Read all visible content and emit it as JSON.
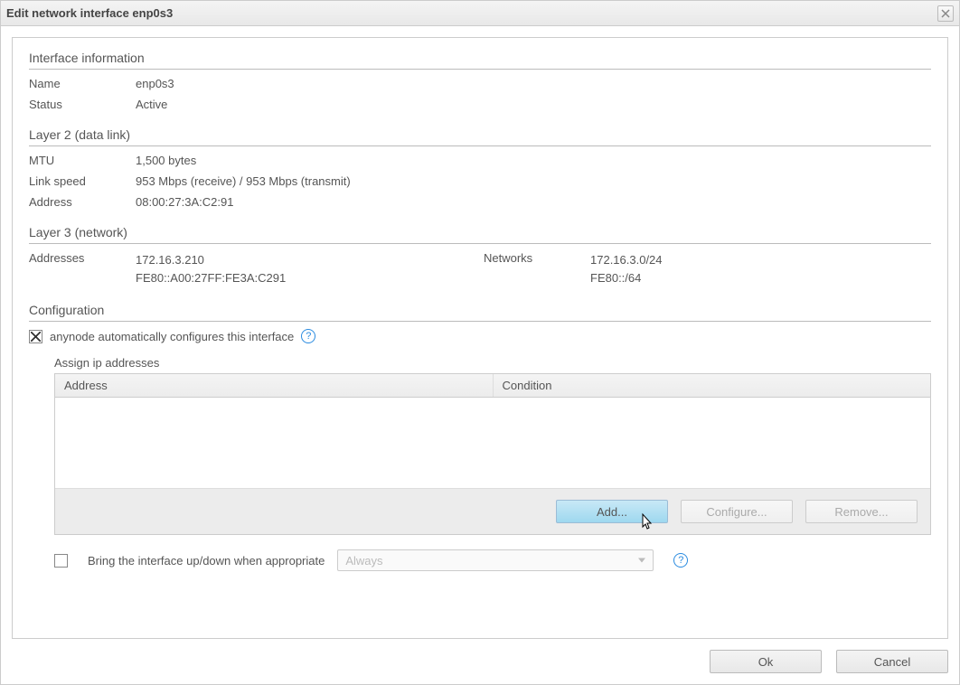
{
  "window": {
    "title": "Edit network interface enp0s3"
  },
  "sections": {
    "interface_info": {
      "heading": "Interface information",
      "name_label": "Name",
      "name_value": "enp0s3",
      "status_label": "Status",
      "status_value": "Active"
    },
    "layer2": {
      "heading": "Layer 2 (data link)",
      "mtu_label": "MTU",
      "mtu_value": "1,500 bytes",
      "linkspeed_label": "Link speed",
      "linkspeed_value": "953 Mbps (receive) / 953 Mbps (transmit)",
      "address_label": "Address",
      "address_value": "08:00:27:3A:C2:91"
    },
    "layer3": {
      "heading": "Layer 3 (network)",
      "addresses_label": "Addresses",
      "addresses_values": [
        "172.16.3.210",
        "FE80::A00:27FF:FE3A:C291"
      ],
      "networks_label": "Networks",
      "networks_values": [
        "172.16.3.0/24",
        "FE80::/64"
      ]
    },
    "configuration": {
      "heading": "Configuration",
      "auto_configure_label": "anynode automatically configures this interface",
      "auto_configure_checked": true,
      "assign_ip_label": "Assign ip addresses",
      "table": {
        "col_address": "Address",
        "col_condition": "Condition",
        "rows": []
      },
      "buttons": {
        "add": "Add...",
        "configure": "Configure...",
        "remove": "Remove..."
      },
      "bring_updown_label": "Bring the interface up/down when appropriate",
      "bring_updown_checked": false,
      "bring_updown_combo_value": "Always"
    }
  },
  "footer": {
    "ok": "Ok",
    "cancel": "Cancel"
  }
}
